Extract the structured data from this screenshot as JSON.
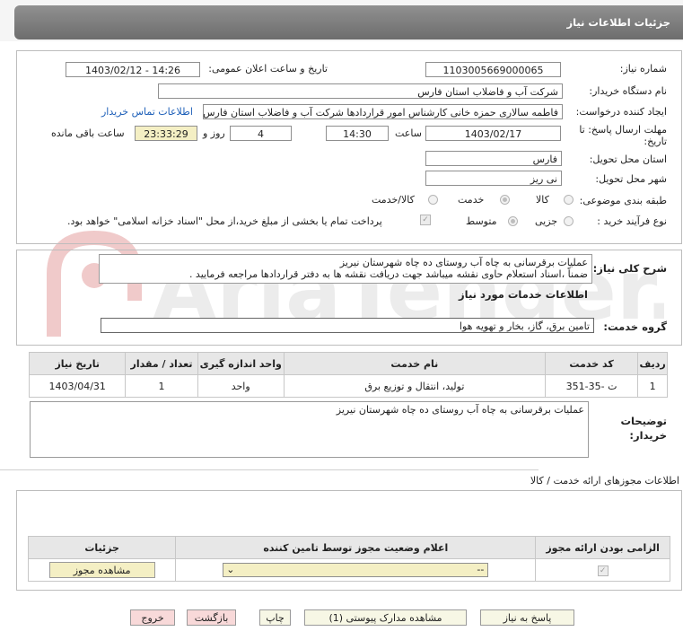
{
  "header": {
    "title": "جزئیات اطلاعات نیاز"
  },
  "form": {
    "need_number_label": "شماره نیاز:",
    "need_number": "1103005669000065",
    "announce_label": "تاریخ و ساعت اعلان عمومی:",
    "announce_value": "1403/02/12 - 14:26",
    "buyer_label": "نام دستگاه خریدار:",
    "buyer_value": "شرکت آب و فاضلاب استان فارس",
    "creator_label": "ایجاد کننده درخواست:",
    "creator_value": "فاطمه سالاری حمزه خانی کارشناس امور قراردادها شرکت آب و فاضلاب استان فارس",
    "contact_link": "اطلاعات تماس خریدار",
    "deadline_label_1": "مهلت ارسال پاسخ: تا",
    "deadline_label_2": "تاریخ:",
    "deadline_date": "1403/02/17",
    "time_label": "ساعت",
    "deadline_time": "14:30",
    "days_value": "4",
    "days_label": "روز و",
    "remaining_value": "23:33:29",
    "remaining_label": "ساعت باقی مانده",
    "province_label": "استان محل تحویل:",
    "province_value": "فارس",
    "city_label": "شهر محل تحویل:",
    "city_value": "نی ریز",
    "category_label": "طبقه بندی موضوعی:",
    "category_options": [
      "کالا",
      "خدمت",
      "کالا/خدمت"
    ],
    "process_label": "نوع فرآیند خرید :",
    "process_options": [
      "جزیی",
      "متوسط"
    ],
    "payment_note": "پرداخت تمام یا بخشی از مبلغ خرید،از محل \"اسناد خزانه اسلامی\" خواهد بود."
  },
  "description": {
    "label": "شرح کلی نیاز:",
    "line1": "عملیات برقرسانی به چاه آب روستای ده چاه شهرستان نیریز",
    "line2": "ضمناً ،اسناد استعلام حاوی نقشه میباشد جهت دریافت نقشه ها به دفتر قراردادها مراجعه فرمایید ."
  },
  "services": {
    "section_title": "اطلاعات خدمات مورد نیاز",
    "group_label": "گروه خدمت:",
    "group_value": "تامین برق، گاز، بخار و تهویه هوا",
    "columns": [
      "ردیف",
      "کد خدمت",
      "نام خدمت",
      "واحد اندازه گیری",
      "تعداد / مقدار",
      "تاریخ نیاز"
    ],
    "rows": [
      [
        "1",
        "ت -35-351",
        "تولید، انتقال و توزیع برق",
        "واحد",
        "1",
        "1403/04/31"
      ]
    ]
  },
  "buyer_notes": {
    "label_1": "توضیحات",
    "label_2": "خریدار:",
    "text": "عملیات برقرسانی به چاه آب روستای ده چاه شهرستان نیریز"
  },
  "permits": {
    "section_title": "اطلاعات مجوزهای ارائه خدمت / کالا",
    "columns": [
      "الزامی بودن ارائه مجوز",
      "اعلام وضعیت مجوز توسط تامین کننده",
      "جزئیات"
    ],
    "select_value": "--",
    "view_button": "مشاهده مجوز"
  },
  "actions": {
    "reply": "پاسخ به نیاز",
    "attachments": "مشاهده مدارک پیوستی (1)",
    "print": "چاپ",
    "back": "بازگشت",
    "exit": "خروج"
  },
  "watermark": {
    "text": "AriaTender.net"
  }
}
